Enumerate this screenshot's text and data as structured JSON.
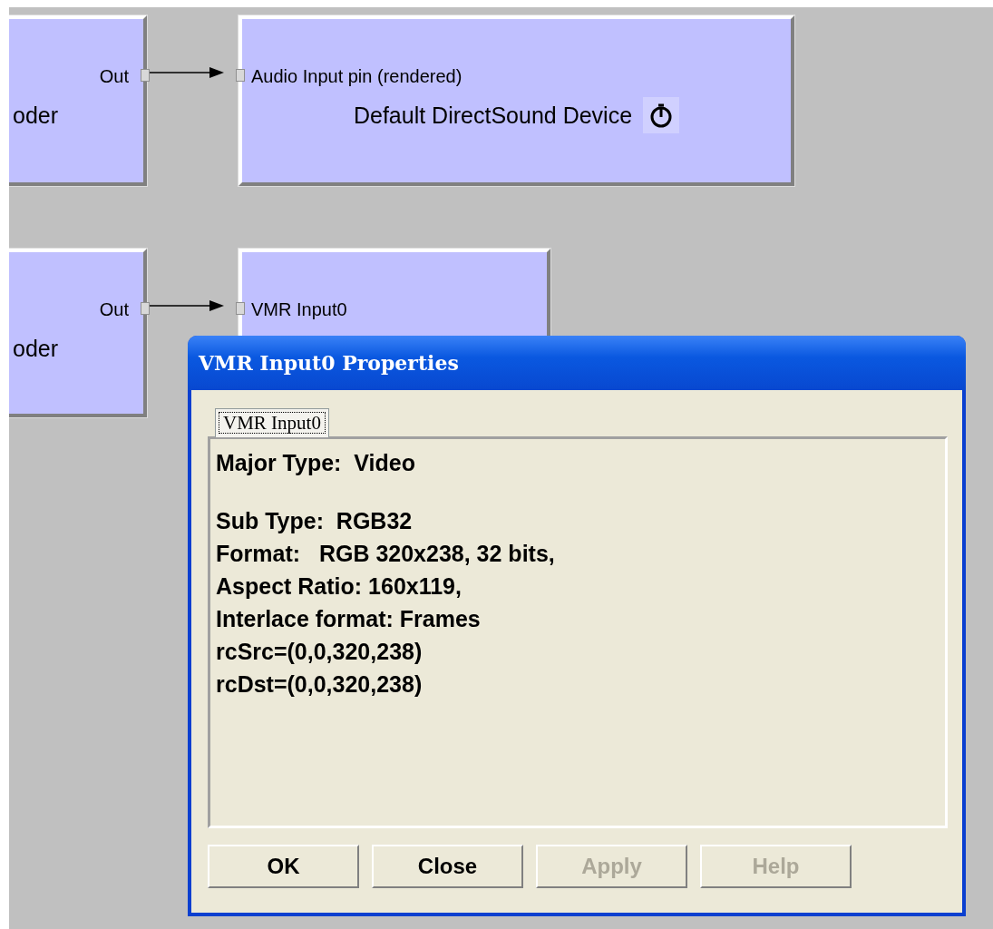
{
  "filters": [
    {
      "name": "oder",
      "pins": [
        {
          "label": "Out",
          "kind": "output"
        }
      ]
    },
    {
      "name": "Default DirectSound Device",
      "clock": true,
      "pins": [
        {
          "label": "Audio Input pin (rendered)",
          "kind": "input"
        }
      ]
    },
    {
      "name": "oder",
      "pins": [
        {
          "label": "Out",
          "kind": "output"
        }
      ]
    },
    {
      "pins": [
        {
          "label": "VMR Input0",
          "kind": "input"
        }
      ]
    }
  ],
  "dialog": {
    "title": "VMR Input0 Properties",
    "tabs": [
      {
        "label": "VMR Input0",
        "selected": true
      }
    ],
    "paragraphs": [
      [
        "Major Type:  Video"
      ],
      [
        "Sub Type:  RGB32",
        "Format:   RGB 320x238, 32 bits,",
        "Aspect Ratio: 160x119,",
        "Interlace format: Frames",
        "rcSrc=(0,0,320,238)",
        "rcDst=(0,0,320,238)"
      ]
    ],
    "buttons": [
      {
        "label": "OK",
        "disabled": false
      },
      {
        "label": "Close",
        "disabled": false
      },
      {
        "label": "Apply",
        "disabled": true
      },
      {
        "label": "Help",
        "disabled": true
      }
    ]
  }
}
